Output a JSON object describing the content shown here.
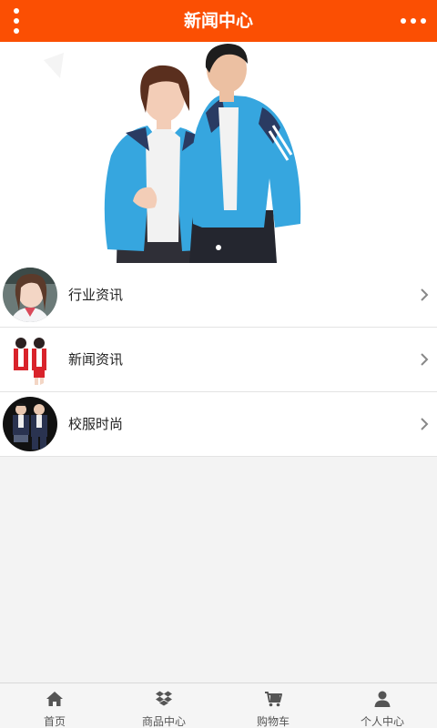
{
  "header": {
    "title": "新闻中心",
    "left_icon": "menu-vertical-dots-icon",
    "right_icon": "more-horizontal-dots-icon",
    "bg_color": "#fb4f03"
  },
  "banner": {
    "image": "couple-in-blue-school-jackets-photo",
    "slides": 1,
    "active_slide": 1
  },
  "categories": [
    {
      "label": "行业资讯",
      "thumb": "student-girl-portrait-photo"
    },
    {
      "label": "新闻资讯",
      "thumb": "kids-red-uniform-photo"
    },
    {
      "label": "校服时尚",
      "thumb": "students-navy-uniform-photo"
    }
  ],
  "tabbar": {
    "items": [
      {
        "label": "首页",
        "icon": "home-icon"
      },
      {
        "label": "商品中心",
        "icon": "dropbox-box-icon"
      },
      {
        "label": "购物车",
        "icon": "cart-icon"
      },
      {
        "label": "个人中心",
        "icon": "user-icon"
      }
    ]
  }
}
